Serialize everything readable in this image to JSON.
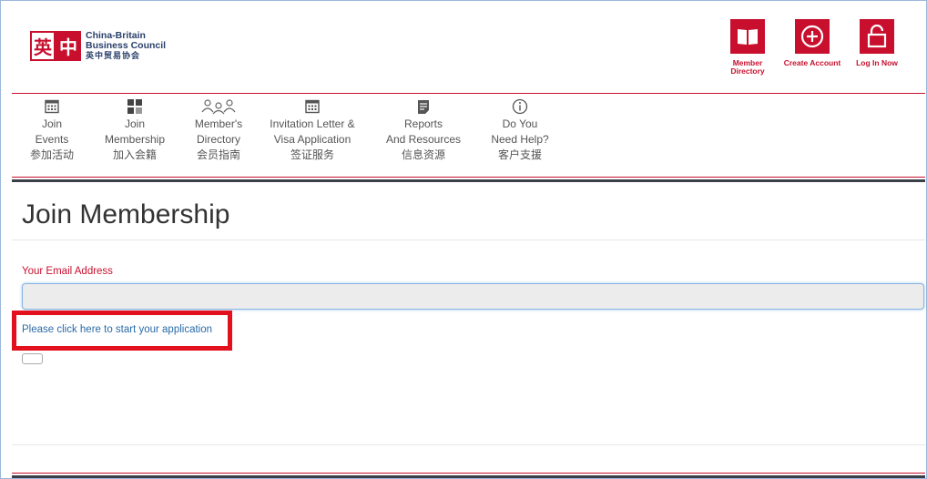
{
  "logo": {
    "mark_left": "英",
    "mark_right": "中",
    "name_line1": "China-Britain",
    "name_line2": "Business Council",
    "name_cn": "英中贸易协会"
  },
  "top_actions": [
    {
      "label_line1": "Member",
      "label_line2": "Directory",
      "icon": "book-icon"
    },
    {
      "label_line1": "Create Account",
      "label_line2": "",
      "icon": "plus-circle-icon"
    },
    {
      "label_line1": "Log In Now",
      "label_line2": "",
      "icon": "unlock-icon"
    }
  ],
  "nav": [
    {
      "l1": "Join",
      "l2": "Events",
      "cn": "参加活动",
      "icon": "calendar-icon"
    },
    {
      "l1": "Join",
      "l2": "Membership",
      "cn": "加入会籍",
      "icon": "grid-icon"
    },
    {
      "l1": "Member's",
      "l2": "Directory",
      "cn": "会员指南",
      "icon": "people-icon"
    },
    {
      "l1": "Invitation Letter &",
      "l2": "Visa Application",
      "cn": "签证服务",
      "icon": "calendar-icon"
    },
    {
      "l1": "Reports",
      "l2": "And Resources",
      "cn": "信息资源",
      "icon": "document-icon"
    },
    {
      "l1": "Do You",
      "l2": "Need Help?",
      "cn": "客户支援",
      "icon": "info-icon"
    }
  ],
  "main": {
    "title": "Join Membership",
    "email_label": "Your Email Address",
    "email_value": "",
    "email_placeholder": "",
    "application_link": "Please click here to start your application"
  },
  "colors": {
    "brand_red": "#c8102e",
    "highlight_red": "#e3101e",
    "link_blue": "#2a6aa8",
    "dark_rule": "#3b3f48"
  }
}
